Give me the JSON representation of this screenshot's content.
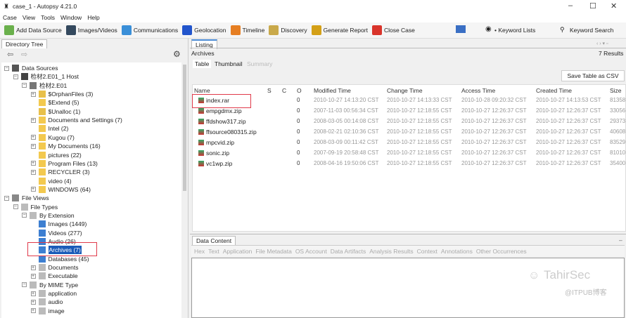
{
  "window": {
    "title": "case_1 - Autopsy 4.21.0",
    "min": "–",
    "max": "☐",
    "close": "✕"
  },
  "menu": [
    "Case",
    "View",
    "Tools",
    "Window",
    "Help"
  ],
  "toolbar": [
    {
      "label": "Add Data Source",
      "icon": "plus-icon",
      "color": "#6ab04c"
    },
    {
      "label": "Images/Videos",
      "icon": "images-icon",
      "color": "#34495e"
    },
    {
      "label": "Communications",
      "icon": "communications-icon",
      "color": "#3a8fd8"
    },
    {
      "label": "Geolocation",
      "icon": "map-pin-icon",
      "color": "#2255cc"
    },
    {
      "label": "Timeline",
      "icon": "timeline-icon",
      "color": "#e67e22"
    },
    {
      "label": "Discovery",
      "icon": "discovery-icon",
      "color": "#c9a94a"
    },
    {
      "label": "Generate Report",
      "icon": "report-icon",
      "color": "#d4a017"
    },
    {
      "label": "Close Case",
      "icon": "close-case-icon",
      "color": "#d9342b"
    }
  ],
  "toolbar_right": {
    "keyword_lists": "• Keyword Lists",
    "keyword_search": "Keyword Search"
  },
  "left": {
    "tab": "Directory Tree"
  },
  "tree": [
    {
      "label": "Data Sources",
      "lvl": 0,
      "exp": "−",
      "icon": "drive"
    },
    {
      "label": "检材2.E01_1 Host",
      "lvl": 1,
      "exp": "−",
      "icon": "host"
    },
    {
      "label": "检材2.E01",
      "lvl": 2,
      "exp": "−",
      "icon": "disk"
    },
    {
      "label": "$OrphanFiles (3)",
      "lvl": 3,
      "exp": "+",
      "icon": "vfolder"
    },
    {
      "label": "$Extend (5)",
      "lvl": 3,
      "exp": "",
      "icon": "folder"
    },
    {
      "label": "$Unalloc (1)",
      "lvl": 3,
      "exp": "",
      "icon": "vfolder"
    },
    {
      "label": "Documents and Settings (7)",
      "lvl": 3,
      "exp": "+",
      "icon": "folder"
    },
    {
      "label": "Intel (2)",
      "lvl": 3,
      "exp": "",
      "icon": "folder"
    },
    {
      "label": "Kugou (7)",
      "lvl": 3,
      "exp": "+",
      "icon": "folder"
    },
    {
      "label": "My Documents (16)",
      "lvl": 3,
      "exp": "+",
      "icon": "folder"
    },
    {
      "label": "pictures (22)",
      "lvl": 3,
      "exp": "",
      "icon": "folder"
    },
    {
      "label": "Program Files (13)",
      "lvl": 3,
      "exp": "+",
      "icon": "folder"
    },
    {
      "label": "RECYCLER (3)",
      "lvl": 3,
      "exp": "+",
      "icon": "folder"
    },
    {
      "label": "video (4)",
      "lvl": 3,
      "exp": "",
      "icon": "folder"
    },
    {
      "label": "WINDOWS (64)",
      "lvl": 3,
      "exp": "+",
      "icon": "folder"
    },
    {
      "label": "File Views",
      "lvl": 0,
      "exp": "−",
      "icon": "eye"
    },
    {
      "label": "File Types",
      "lvl": 1,
      "exp": "−",
      "icon": "filetype"
    },
    {
      "label": "By Extension",
      "lvl": 2,
      "exp": "−",
      "icon": "filetype"
    },
    {
      "label": "Images (1449)",
      "lvl": 3,
      "exp": "",
      "icon": "file"
    },
    {
      "label": "Videos (277)",
      "lvl": 3,
      "exp": "",
      "icon": "file"
    },
    {
      "label": "Audio (26)",
      "lvl": 3,
      "exp": "",
      "icon": "file"
    },
    {
      "label": "Archives (7)",
      "lvl": 3,
      "exp": "",
      "icon": "file",
      "selected": true
    },
    {
      "label": "Databases (45)",
      "lvl": 3,
      "exp": "",
      "icon": "file"
    },
    {
      "label": "Documents",
      "lvl": 3,
      "exp": "+",
      "icon": "filetype"
    },
    {
      "label": "Executable",
      "lvl": 3,
      "exp": "+",
      "icon": "filetype"
    },
    {
      "label": "By MIME Type",
      "lvl": 2,
      "exp": "−",
      "icon": "filetype"
    },
    {
      "label": "application",
      "lvl": 3,
      "exp": "+",
      "icon": "filetype"
    },
    {
      "label": "audio",
      "lvl": 3,
      "exp": "+",
      "icon": "filetype"
    },
    {
      "label": "image",
      "lvl": 3,
      "exp": "+",
      "icon": "filetype"
    }
  ],
  "listing": {
    "tab": "Listing",
    "title": "Archives",
    "results": "7 Results",
    "views": [
      "Table",
      "Thumbnail",
      "Summary"
    ],
    "save_csv": "Save Table as CSV"
  },
  "columns": [
    "Name",
    "S",
    "C",
    "O",
    "Modified Time",
    "Change Time",
    "Access Time",
    "Created Time",
    "Size"
  ],
  "rows": [
    [
      "index.rar",
      "",
      "",
      "0",
      "2010-10-27 14:13:20 CST",
      "2010-10-27 14:13:33 CST",
      "2010-10-28 09:20:32 CST",
      "2010-10-27 14:13:53 CST",
      "81358"
    ],
    [
      "empgdmx.zip",
      "",
      "",
      "0",
      "2007-11-03 00:56:34 CST",
      "2010-10-27 12:18:55 CST",
      "2010-10-27 12:26:37 CST",
      "2010-10-27 12:26:37 CST",
      "33056"
    ],
    [
      "ffdshow317.zip",
      "",
      "",
      "0",
      "2008-03-05 00:14:08 CST",
      "2010-10-27 12:18:55 CST",
      "2010-10-27 12:26:37 CST",
      "2010-10-27 12:26:37 CST",
      "29373"
    ],
    [
      "ffsource080315.zip",
      "",
      "",
      "0",
      "2008-02-21 02:10:36 CST",
      "2010-10-27 12:18:55 CST",
      "2010-10-27 12:26:37 CST",
      "2010-10-27 12:26:37 CST",
      "40608"
    ],
    [
      "mpcvid.zip",
      "",
      "",
      "0",
      "2008-03-09 00:11:42 CST",
      "2010-10-27 12:18:55 CST",
      "2010-10-27 12:26:37 CST",
      "2010-10-27 12:26:37 CST",
      "83529"
    ],
    [
      "sonic.zip",
      "",
      "",
      "0",
      "2007-09-19 20:58:48 CST",
      "2010-10-27 12:18:55 CST",
      "2010-10-27 12:26:37 CST",
      "2010-10-27 12:26:37 CST",
      "81010"
    ],
    [
      "vc1wp.zip",
      "",
      "",
      "0",
      "2008-04-16 19:50:06 CST",
      "2010-10-27 12:18:55 CST",
      "2010-10-27 12:26:37 CST",
      "2010-10-27 12:26:37 CST",
      "35400"
    ]
  ],
  "data_content": {
    "tab": "Data Content",
    "subtabs": [
      "Hex",
      "Text",
      "Application",
      "File Metadata",
      "OS Account",
      "Data Artifacts",
      "Analysis Results",
      "Context",
      "Annotations",
      "Other Occurrences"
    ]
  },
  "watermark": {
    "line1": "TahirSec",
    "line2": "@ITPUB博客"
  }
}
